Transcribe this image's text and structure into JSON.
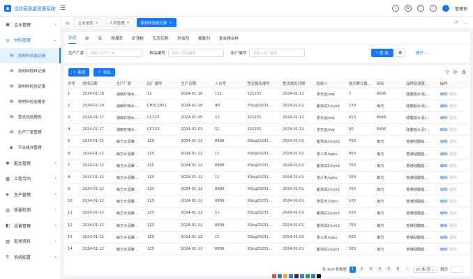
{
  "app": {
    "title": "试验室质量管理系统",
    "user": "管理员"
  },
  "icons": {
    "hamburger": "☰",
    "search": "⌕",
    "user": "⚙",
    "fullscreen": "⛶",
    "bell": "♪"
  },
  "sidebar": [
    {
      "label": "企业管理",
      "icon": "▣",
      "arrow": "›",
      "open": false
    },
    {
      "label": "材料管理",
      "icon": "◎",
      "arrow": "⌄",
      "open": true,
      "children": [
        {
          "label": "原材料验收记录",
          "icon": "▤",
          "active": true
        },
        {
          "label": "原材料取样记录",
          "icon": "▤"
        },
        {
          "label": "原材料检验记录",
          "icon": "▤"
        },
        {
          "label": "原材料检验报告",
          "icon": "▤"
        },
        {
          "label": "型式检验报告",
          "icon": "▤"
        },
        {
          "label": "生产厂家管理",
          "icon": "▤"
        },
        {
          "label": "不合格详管理",
          "icon": "▲"
        }
      ]
    },
    {
      "label": "配比管理",
      "icon": "◉",
      "arrow": "›"
    },
    {
      "label": "工程合同",
      "icon": "▦",
      "arrow": "›"
    },
    {
      "label": "生产管理",
      "icon": "◈",
      "arrow": "›"
    },
    {
      "label": "质量检测",
      "icon": "▥",
      "arrow": "›"
    },
    {
      "label": "设备管理",
      "icon": "◧",
      "arrow": "›"
    },
    {
      "label": "现场资料",
      "icon": "▨",
      "arrow": "›"
    },
    {
      "label": "系统配置",
      "icon": "✲",
      "arrow": "›"
    }
  ],
  "pagetabs": [
    {
      "label": "企业信息",
      "close": "×"
    },
    {
      "label": "人员管理",
      "close": "×"
    },
    {
      "label": "原材料验收记录",
      "close": "×",
      "active": true
    }
  ],
  "tab_tools": {
    "refresh": "⟳",
    "more": "⌄"
  },
  "material_tabs": [
    "水泥",
    "砂",
    "石",
    "粉煤灰",
    "矿渣粉",
    "石灰石粉",
    "外加剂",
    "膨胀剂",
    "复合掺合料"
  ],
  "filters": [
    {
      "label": "生产厂家",
      "placeholder": "请输入生产厂家",
      "width": 80
    },
    {
      "label": "样品编号",
      "placeholder": "请输入样品编号",
      "width": 80
    },
    {
      "label": "出厂编号",
      "placeholder": "请输入出厂编号",
      "width": 80
    }
  ],
  "buttons": {
    "query": "查 询",
    "query_icon": "⌕",
    "reset": "▦",
    "expand": "展开 ⌄",
    "add": "新增",
    "add_icon": "+",
    "export": "导出",
    "export_icon": "⇩"
  },
  "tb_icons": {
    "filter": "▽",
    "refresh": "⟳",
    "settings": "⚙"
  },
  "table": {
    "columns": [
      "序号",
      "进场日期",
      "生产厂家",
      "出厂编号",
      "生产日期",
      "入仓号",
      "型式报告编号",
      "型式报告日期",
      "验收人",
      "批次累计数...",
      "商标",
      "品种及强度...",
      "操作"
    ],
    "rows": [
      [
        "1",
        "2024-01-18",
        "湖南红瑞水...",
        "11",
        "2024-01-18",
        "111",
        "321231",
        "2024-01-11",
        "张无远/zwj",
        "7",
        "6666",
        "硅酸盐水泥/..."
      ],
      [
        "2",
        "2024-01-18",
        "湖南红瑞水...",
        "CH011801",
        "2024-01-18",
        "#3",
        "XSbg20231...",
        "2024-01-01",
        "崔测试2/cyk2",
        "150",
        "南方",
        "硅酸盐水泥/..."
      ],
      [
        "3",
        "2024-01-17",
        "湖南红瑞水...",
        "CC123",
        "2024-01-05",
        "12",
        "321231",
        "2024-01-11",
        "张无远/zwj",
        "410",
        "6666",
        "硅酸盐水泥/..."
      ],
      [
        "4",
        "2024-01-17",
        "湖南红瑞水...",
        "CC123",
        "2024-01-03",
        "12",
        "321231",
        "2024-01-11",
        "张无远/zwj",
        "60",
        "6666",
        "硅酸盐水泥/..."
      ],
      [
        "5",
        "2024-01-12",
        "南方水泥聚...",
        "125",
        "2024-01-12",
        "8989",
        "XSbg20231...",
        "2024-01-01",
        "崔测试2/cyk2",
        "700",
        "南方",
        "普通硅酸盐..."
      ],
      [
        "6",
        "2024-01-12",
        "南方水泥聚...",
        "125",
        "2024-01-12",
        "11",
        "XSbg20231...",
        "2024-01-01",
        "张三丰/zpku",
        "800",
        "南方",
        "普通硅酸盐..."
      ],
      [
        "7",
        "2024-01-12",
        "南方水泥聚...",
        "125",
        "2024-01-12",
        "8989",
        "XSbg20231...",
        "2024-01-01",
        "崔测试2/cyk2",
        "700",
        "南方",
        "普通硅酸盐..."
      ],
      [
        "8",
        "2024-01-12",
        "南方水泥聚...",
        "125",
        "2024-01-12",
        "11",
        "XSbg20231...",
        "2024-01-01",
        "张三丰/zpku",
        "200",
        "南方",
        "普通硅酸盐..."
      ],
      [
        "9",
        "2024-01-12",
        "南方水泥聚...",
        "125",
        "2024-01-12",
        "8989",
        "XSbg20231...",
        "2024-01-01",
        "崔测试2/cyk2",
        "700",
        "南方",
        "普通硅酸盐..."
      ],
      [
        "10",
        "2024-01-12",
        "南方水泥聚...",
        "125",
        "2024-01-12",
        "8989",
        "XSbg20231...",
        "2024-01-01",
        "李思/fLSifen",
        "100",
        "南方",
        "普通硅酸盐..."
      ],
      [
        "11",
        "2024-01-12",
        "南方水泥聚...",
        "125",
        "2024-01-12",
        "11",
        "XSbg20231...",
        "2024-01-01",
        "崔测试2/cyk2",
        "100",
        "南方",
        "普通硅酸盐..."
      ],
      [
        "12",
        "2024-01-12",
        "南方水泥聚...",
        "125",
        "2024-01-12",
        "8989",
        "XSbg20231...",
        "2024-01-01",
        "崔测试2/cyk2",
        "700",
        "南方",
        "普通硅酸盐..."
      ],
      [
        "13",
        "2024-01-12",
        "南方水泥聚...",
        "125",
        "2024-01-12",
        "11",
        "XSbg20231...",
        "2024-01-01",
        "张三丰/zpku",
        "600",
        "南方",
        "普通硅酸盐..."
      ],
      [
        "14",
        "2024-01-12",
        "南方水泥聚...",
        "125",
        "2024-01-12",
        "8989",
        "XSbg20231...",
        "2024-01-01",
        "崔测试1/cyk1",
        "300",
        "南方",
        "普通硅酸盐..."
      ]
    ],
    "action_edit": "编辑",
    "action_more": "删除"
  },
  "pager": {
    "total": "共 104 条数据",
    "pages": [
      "1",
      "2",
      "3",
      "4",
      "5",
      "6"
    ],
    "next": "›",
    "size": "20 条/页 ⌄",
    "jump": "跳至"
  }
}
